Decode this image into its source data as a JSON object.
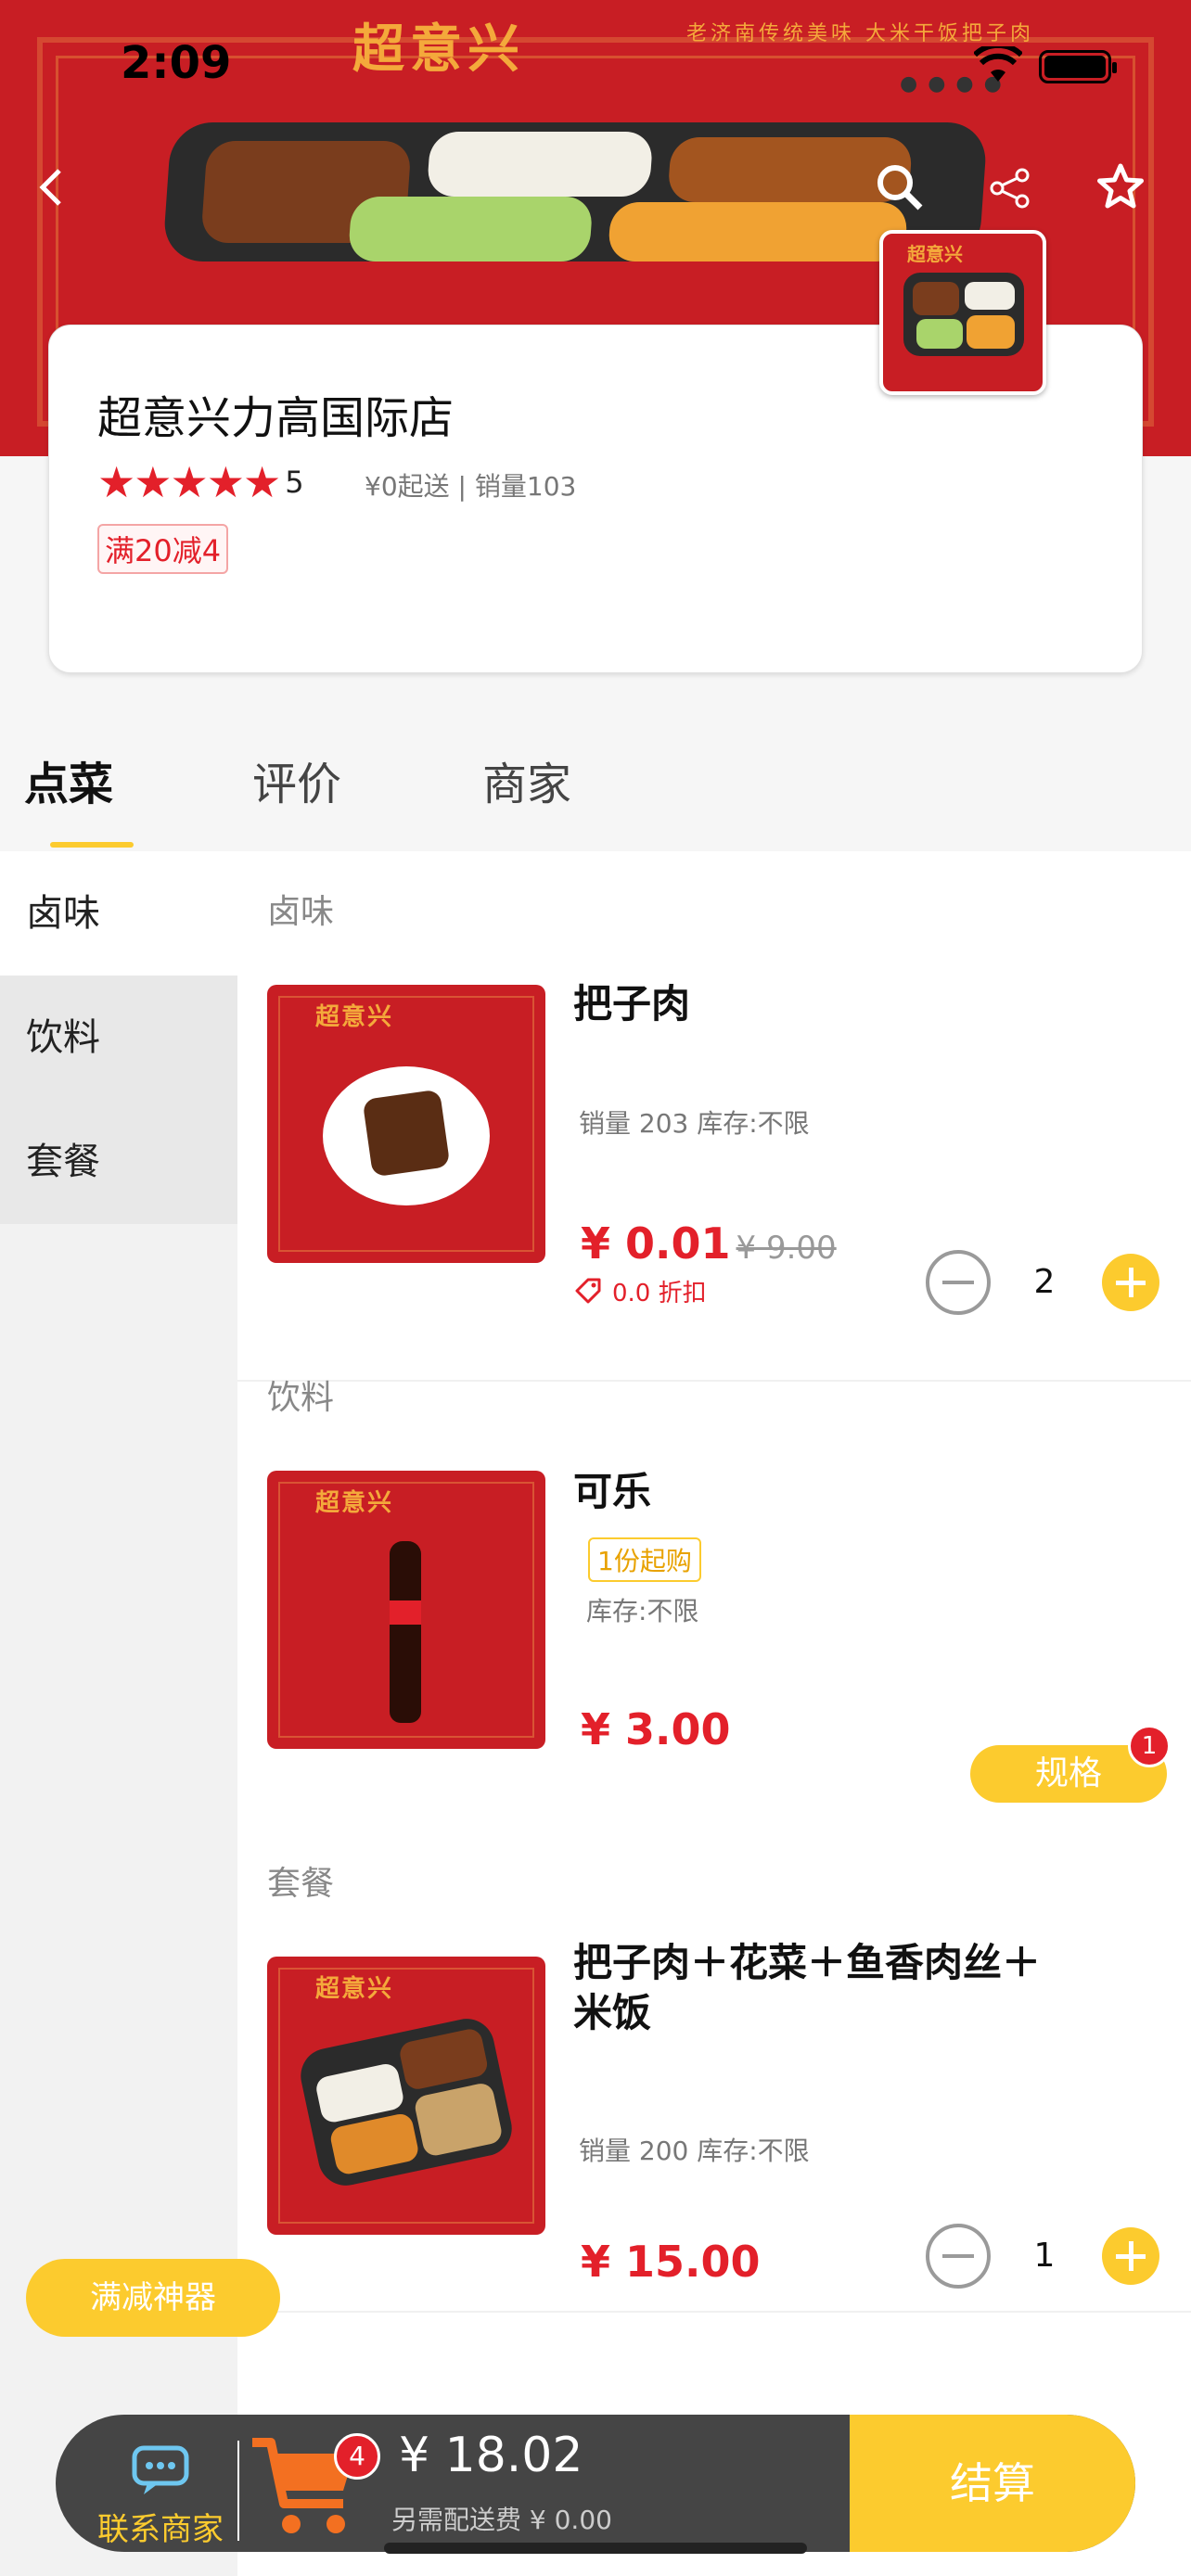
{
  "status_bar": {
    "time": "2:09"
  },
  "banner": {
    "brand": "超意兴",
    "slogan": "老济南传统美味 大米干饭把子肉"
  },
  "nav": {
    "back_icon": "chevron-left-icon",
    "search_icon": "search-icon",
    "share_icon": "share-icon",
    "favorite_icon": "star-outline-icon"
  },
  "shop": {
    "name": "超意兴力高国际店",
    "rating": "5",
    "min_order": "¥0起送",
    "sales": "销量103",
    "promotion": "满20减4"
  },
  "tabs": [
    {
      "label": "点菜",
      "active": true
    },
    {
      "label": "评价",
      "active": false
    },
    {
      "label": "商家",
      "active": false
    }
  ],
  "sidebar": [
    {
      "label": "卤味"
    },
    {
      "label": "饮料"
    },
    {
      "label": "套餐"
    }
  ],
  "sections": [
    {
      "title": "卤味",
      "items": [
        {
          "name": "把子肉",
          "meta": "销量 203 库存:不限",
          "price": "¥ 0.01",
          "old_price": "¥ 9.00",
          "discount": "0.0 折扣",
          "quantity": "2",
          "thumb_brand": "超意兴"
        }
      ]
    },
    {
      "title": "饮料",
      "items": [
        {
          "name": "可乐",
          "min_buy": "1份起购",
          "meta": "库存:不限",
          "price": "¥ 3.00",
          "spec_label": "规格",
          "spec_badge": "1",
          "thumb_brand": "超意兴"
        }
      ]
    },
    {
      "title": "套餐",
      "items": [
        {
          "name": "把子肉＋花菜＋鱼香肉丝＋米饭",
          "meta": "销量 200 库存:不限",
          "price": "¥ 15.00",
          "quantity": "1",
          "thumb_brand": "超意兴"
        }
      ]
    }
  ],
  "float_button": "满减神器",
  "cart": {
    "contact_label": "联系商家",
    "badge": "4",
    "total": "¥ 18.02",
    "delivery": "另需配送费 ¥ 0.00",
    "checkout_label": "结算"
  },
  "colors": {
    "primary_red": "#c81e24",
    "accent_yellow": "#fccb2e",
    "price_red": "#e3202a"
  }
}
